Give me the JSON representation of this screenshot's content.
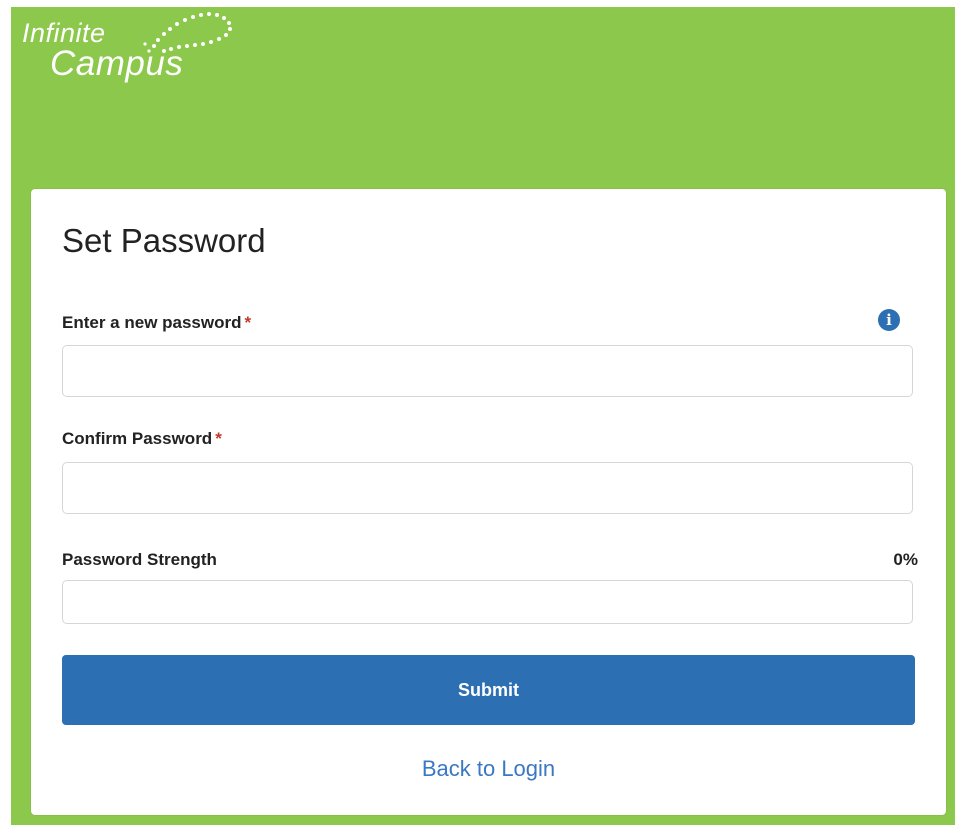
{
  "brand": {
    "line1": "Infinite",
    "line2": "Campus",
    "color": "#8cc84b"
  },
  "form": {
    "title": "Set Password",
    "new_password_label": "Enter a new password",
    "confirm_password_label": "Confirm Password",
    "required_marker": "*",
    "strength_label": "Password Strength",
    "strength_value": "0%",
    "strength_fraction": 0,
    "new_password_value": "",
    "confirm_password_value": "",
    "info_icon": "info-circle-icon"
  },
  "actions": {
    "submit_label": "Submit",
    "back_link_label": "Back to Login",
    "accent": "#2c6fb2"
  }
}
